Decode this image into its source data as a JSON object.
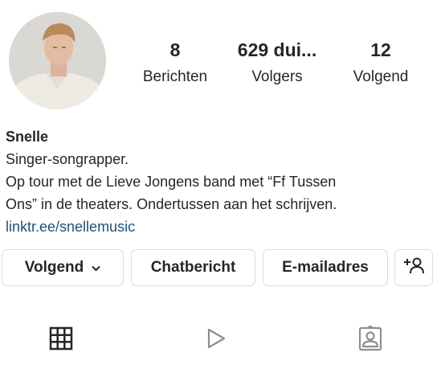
{
  "profile": {
    "stats": {
      "posts_count": "8",
      "posts_label": "Berichten",
      "followers_count": "629 dui...",
      "followers_label": "Volgers",
      "following_count": "12",
      "following_label": "Volgend"
    },
    "name": "Snelle",
    "bio_line1": "Singer-songrapper.",
    "bio_line2": "Op tour met de Lieve Jongens band met “Ff Tussen",
    "bio_line3": "Ons” in de theaters. Ondertussen aan het schrijven.",
    "link": "linktr.ee/snellemusic"
  },
  "actions": {
    "following_label": "Volgend",
    "message_label": "Chatbericht",
    "email_label": "E-mailadres"
  },
  "tabs": [
    {
      "icon": "grid-icon",
      "active": true
    },
    {
      "icon": "reels-play-icon",
      "active": false
    },
    {
      "icon": "tagged-person-icon",
      "active": false
    }
  ],
  "colors": {
    "text": "#262626",
    "link": "#1f4f7a",
    "button_border": "#dbdbdb",
    "inactive_icon": "#8e8e8e"
  }
}
